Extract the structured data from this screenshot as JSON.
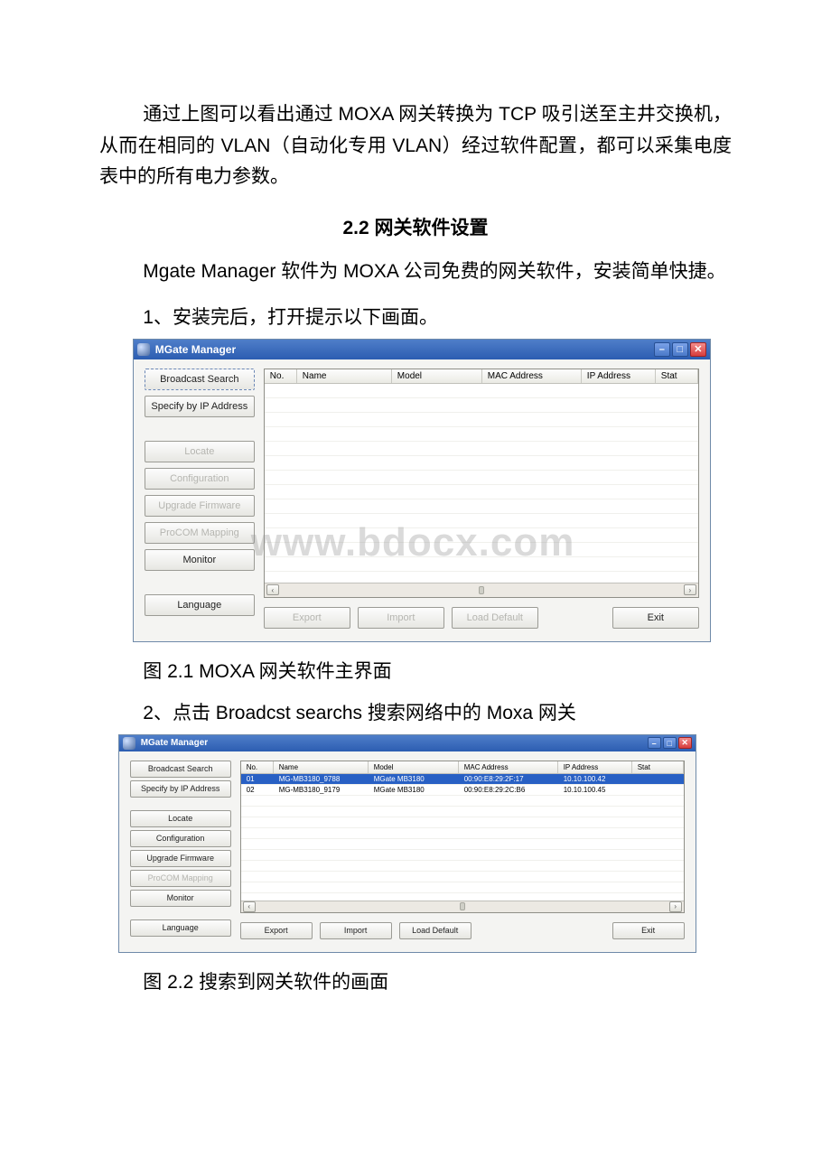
{
  "text": {
    "para1": "通过上图可以看出通过 MOXA 网关转换为 TCP 吸引送至主井交换机，从而在相同的 VLAN（自动化专用 VLAN）经过软件配置，都可以采集电度表中的所有电力参数。",
    "heading22": "2.2 网关软件设置",
    "para2": "Mgate Manager 软件为 MOXA 公司免费的网关软件，安装简单快捷。",
    "step1": "1、安装完后，打开提示以下画面。",
    "caption21": "图 2.1 MOXA 网关软件主界面",
    "step2": "2、点击 Broadcst searchs 搜索网络中的 Moxa 网关",
    "caption22": "图 2.2 搜索到网关软件的画面",
    "watermark": "www.bdocx.com"
  },
  "window": {
    "title": "MGate Manager",
    "sidebar": {
      "broadcast": "Broadcast Search",
      "specify": "Specify by IP Address",
      "locate": "Locate",
      "config": "Configuration",
      "upgrade": "Upgrade Firmware",
      "procom": "ProCOM Mapping",
      "monitor": "Monitor",
      "language": "Language"
    },
    "columns": {
      "no": "No.",
      "name": "Name",
      "model": "Model",
      "mac": "MAC Address",
      "ip": "IP Address",
      "stat": "Stat"
    },
    "bottom": {
      "export": "Export",
      "import": "Import",
      "loaddef": "Load Default",
      "exit": "Exit"
    }
  },
  "win1": {
    "rows": []
  },
  "win2": {
    "rows": [
      {
        "no": "01",
        "name": "MG-MB3180_9788",
        "model": "MGate MB3180",
        "mac": "00:90:E8:29:2F:17",
        "ip": "10.10.100.42",
        "sel": true
      },
      {
        "no": "02",
        "name": "MG-MB3180_9179",
        "model": "MGate MB3180",
        "mac": "00:90:E8:29:2C:B6",
        "ip": "10.10.100.45",
        "sel": false
      }
    ]
  }
}
